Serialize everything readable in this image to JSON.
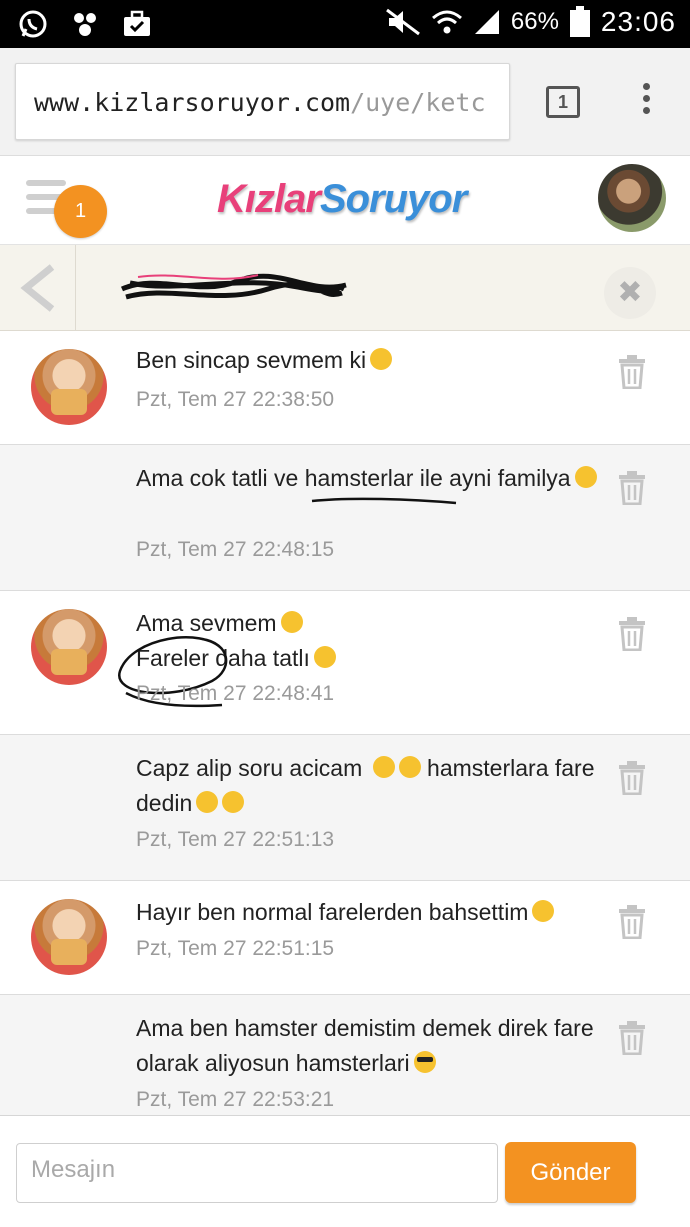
{
  "status_bar": {
    "battery": "66%",
    "time": "23:06"
  },
  "browser": {
    "url_host": "www.kizlarsoruyor.com",
    "url_path": "/uye/ketc",
    "tab_count": "1"
  },
  "header": {
    "logo_part1": "Kızlar",
    "logo_part2": "Soruyor",
    "notification_count": "1"
  },
  "conversation": {
    "name": ""
  },
  "messages": [
    {
      "sender": "them",
      "text": "Ben sincap sevmem ki",
      "emoji": "unamused",
      "time": "Pzt, Tem 27 22:38:50"
    },
    {
      "sender": "me",
      "text": "Ama cok tatli ve hamsterlar ile ayni familya",
      "emoji": "relieved",
      "time": "Pzt, Tem 27 22:48:15"
    },
    {
      "sender": "them",
      "text_line1": "Ama sevmem",
      "text_line2": "Fareler daha tatlı",
      "time": "Pzt, Tem 27 22:48:41"
    },
    {
      "sender": "me",
      "text_a": "Capz alip soru acicam",
      "text_b": "hamsterlara fare dedin",
      "time": "Pzt, Tem 27 22:51:13"
    },
    {
      "sender": "them",
      "text": "Hayır ben normal farelerden bahsettim",
      "emoji": "angry",
      "time": "Pzt, Tem 27 22:51:15"
    },
    {
      "sender": "me",
      "text": "Ama ben hamster demistim demek direk fare olarak aliyosun hamsterlari",
      "emoji": "sunglasses",
      "time": "Pzt, Tem 27 22:53:21"
    }
  ],
  "composer": {
    "placeholder": "Mesajın",
    "send_label": "Gönder"
  },
  "colors": {
    "accent_orange": "#f39221",
    "logo_pink": "#e8407a",
    "logo_blue": "#3a8fd9"
  }
}
